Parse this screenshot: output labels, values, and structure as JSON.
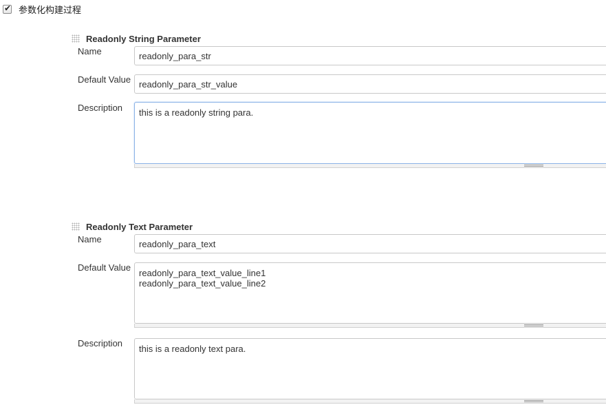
{
  "top_option": {
    "checked": true,
    "label": "参数化构建过程"
  },
  "sections": [
    {
      "title": "Readonly String Parameter",
      "fields": {
        "name_label": "Name",
        "name_value": "readonly_para_str",
        "default_label": "Default Value",
        "default_value": "readonly_para_str_value",
        "description_label": "Description",
        "description_value": "this is a readonly string para."
      }
    },
    {
      "title": "Readonly Text Parameter",
      "fields": {
        "name_label": "Name",
        "name_value": "readonly_para_text",
        "default_label": "Default Value",
        "default_value": "readonly_para_text_value_line1\nreadonly_para_text_value_line2",
        "description_label": "Description",
        "description_value": "this is a readonly text para."
      }
    }
  ],
  "icons": {
    "checkbox": "checkmark-icon",
    "section_handle": "drag-handle-icon",
    "resize": "resize-grip-icon"
  },
  "colors": {
    "focus_border": "#8ab2e6",
    "input_border": "#c8c8c8",
    "text": "#333333"
  }
}
